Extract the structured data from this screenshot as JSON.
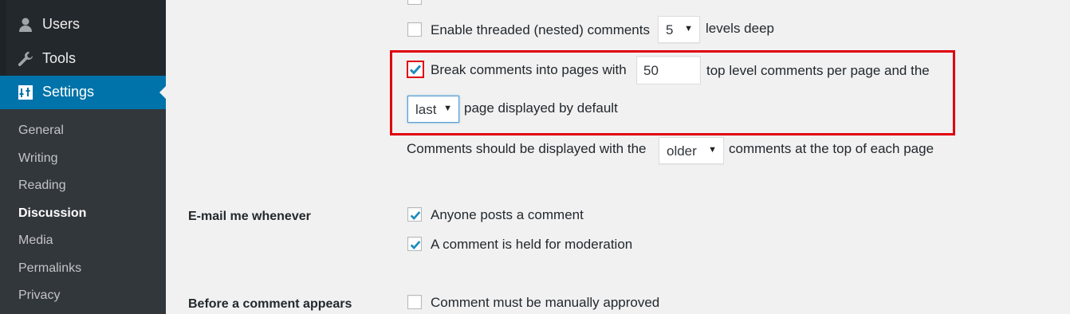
{
  "sidebar": {
    "menu": [
      {
        "label": "Users",
        "icon": "user-icon"
      },
      {
        "label": "Tools",
        "icon": "wrench-icon"
      },
      {
        "label": "Settings",
        "icon": "settings-icon"
      }
    ],
    "submenu": [
      "General",
      "Writing",
      "Reading",
      "Discussion",
      "Media",
      "Permalinks",
      "Privacy"
    ],
    "current": "Discussion",
    "accent_color": "#0073aa"
  },
  "comments": {
    "threaded_label_before": "Enable threaded (nested) comments",
    "threaded_levels": "5",
    "threaded_label_after": "levels deep",
    "break_label_before": "Break comments into pages with",
    "per_page": "50",
    "break_label_after": "top level comments per page and the",
    "default_page": "last",
    "default_page_label": "page displayed by default",
    "order_label_before": "Comments should be displayed with the",
    "order": "older",
    "order_label_after": "comments at the top of each page"
  },
  "email": {
    "heading": "E-mail me whenever",
    "opt1": "Anyone posts a comment",
    "opt2": "A comment is held for moderation"
  },
  "before": {
    "heading": "Before a comment appears",
    "opt1": "Comment must be manually approved"
  },
  "highlight_color": "#e0000f"
}
